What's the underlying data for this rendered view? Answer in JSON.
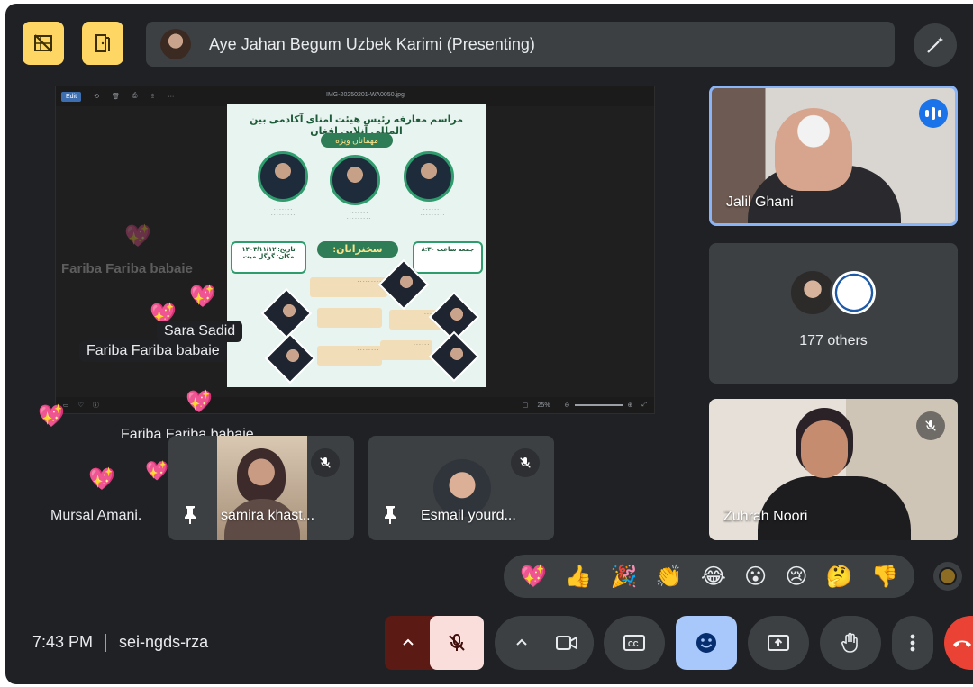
{
  "header": {
    "presenter_name": "Aye Jahan Begum Uzbek Karimi (Presenting)",
    "left_icons": [
      "hide-tiles-icon",
      "exit-room-icon"
    ],
    "right_icon": "magic-wand-icon"
  },
  "viewer": {
    "file_name": "IMG-20250201-WA0050.jpg",
    "edit_label": "Edit",
    "zoom": "25%"
  },
  "poster": {
    "title": "مراسم معارفه رئیس هیئت امنای آکادمی بین المللی آنلاین افغان",
    "special_guests": "مهمانان ویژه",
    "speakers_title": "سخنرانان:",
    "date_label": "تاریخ: ۱۴۰۳/۱۱/۱۲",
    "place_label": "مکان: گوگل میت",
    "time_box": "جمعه ساعت ۸:۳۰"
  },
  "reactions": [
    {
      "name": "Fariba Fariba babaie"
    },
    {
      "name": "Sara Sadid"
    },
    {
      "name": "Fariba Fariba babaie"
    },
    {
      "name": "Fariba Fariba babaie"
    },
    {
      "name": "Mursal Amani."
    }
  ],
  "participants": {
    "jalil": {
      "name": "Jalil Ghani"
    },
    "others": {
      "label": "177 others"
    },
    "zuhrah": {
      "name": "Zuhrah Noori"
    },
    "samira": {
      "name": "samira khast..."
    },
    "esmail": {
      "name": "Esmail yourd..."
    }
  },
  "emojis": [
    "💖",
    "👍",
    "🎉",
    "👏",
    "😂",
    "😮",
    "😢",
    "🤔",
    "👎"
  ],
  "footer": {
    "time": "7:43 PM",
    "meeting_code": "sei-ngds-rza"
  },
  "colors": {
    "accent_yellow": "#fdd663",
    "active_blue": "#8ab4f8",
    "mic_off_red": "#f9dedc",
    "leave_red": "#ea4335"
  }
}
